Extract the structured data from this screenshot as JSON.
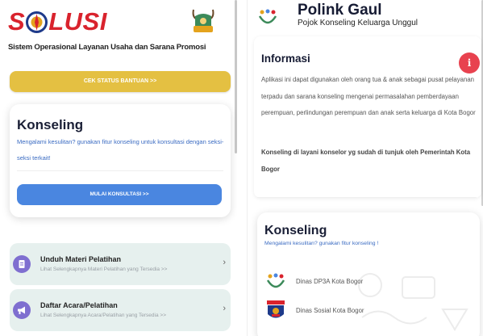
{
  "left_panel": {
    "brand": {
      "prefix": "S",
      "suffix": "LUSI",
      "tagline": "Sistem Operasional Layanan Usaha dan Sarana Promosi",
      "brand_color": "#d9232d"
    },
    "cek_status_button": {
      "label": "CEK STATUS BANTUAN >>",
      "color": "#e4c042"
    },
    "konseling_card": {
      "title": "Konseling",
      "subtitle": "Mengalami kesulitan? gunakan fitur konseling untuk konsultasi dengan seksi-seksi terkait!",
      "button_label": "MULAI KONSULTASI >>",
      "button_color": "#4a86e0"
    },
    "menu_items": [
      {
        "title": "Unduh Materi Pelatihan",
        "subtitle": "Lihat Selengkapnya Materi Pelatihan yang Tersedia >>",
        "icon": "document-icon",
        "chevron": "›"
      },
      {
        "title": "Daftar Acara/Pelatihan",
        "subtitle": "Lihat Selengkapnya Acara/Pelatihan yang Tersedia >>",
        "icon": "megaphone-icon",
        "chevron": "›"
      }
    ]
  },
  "right_panel": {
    "header": {
      "title": "Polink Gaul",
      "subtitle": "Pojok Konseling Keluarga Unggul",
      "logo_text": "DP3A"
    },
    "info": {
      "title": "Informasi",
      "alert_glyph": "i",
      "body": "Aplikasi ini dapat digunakan oleh orang tua & anak sebagai pusat pelayanan terpadu dan sarana konseling mengenai permasalahan pemberdayaan perempuan, perlindungan perempuan dan anak serta keluarga di Kota Bogor",
      "note": "Konseling di layani konselor yg sudah di tunjuk oleh Pemerintah Kota Bogor"
    },
    "konseling": {
      "title": "Konseling",
      "subtitle": "Mengalami kesulitan? gunakan fitur konseling !",
      "orgs": [
        {
          "label": "Dinas DP3A Kota Bogor",
          "icon": "dp3a-logo-icon"
        },
        {
          "label": "Dinas Sosial Kota Bogor",
          "icon": "kota-bogor-crest-icon"
        }
      ]
    }
  },
  "colors": {
    "alert": "#e8424f",
    "link_blue": "#3a6bc2",
    "menu_bg": "#e6f0ee",
    "menu_icon": "#7f6fd0"
  }
}
